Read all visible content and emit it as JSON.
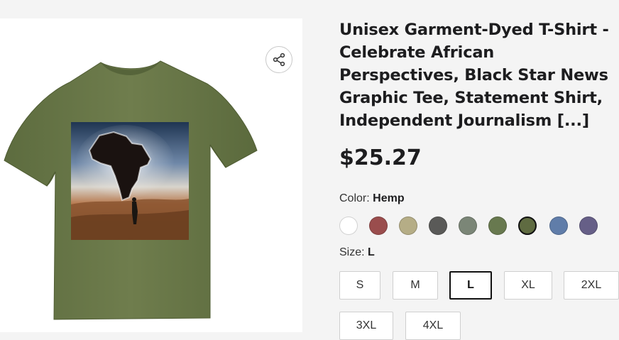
{
  "product": {
    "title": "Unisex Garment-Dyed T-Shirt - Celebrate African Perspectives, Black Star News Graphic Tee, Statement Shirt, Independent Journalism [...]",
    "price": "$25.27",
    "image": {
      "icon": "share-icon"
    }
  },
  "color": {
    "label": "Color:",
    "selected": "Hemp",
    "swatches": [
      {
        "name": "white",
        "hex": "#ffffff"
      },
      {
        "name": "brick",
        "hex": "#9a4d4d"
      },
      {
        "name": "ivory-khaki",
        "hex": "#b5ad86"
      },
      {
        "name": "pepper",
        "hex": "#5a5a58"
      },
      {
        "name": "moss-grey",
        "hex": "#7b8677"
      },
      {
        "name": "sage-green",
        "hex": "#68794f"
      },
      {
        "name": "hemp",
        "hex": "#5f6b41",
        "selected": true
      },
      {
        "name": "blue",
        "hex": "#607da9"
      },
      {
        "name": "grape",
        "hex": "#665f87"
      }
    ]
  },
  "size": {
    "label": "Size:",
    "selected": "L",
    "options": [
      "S",
      "M",
      "L",
      "XL",
      "2XL",
      "3XL",
      "4XL"
    ]
  }
}
